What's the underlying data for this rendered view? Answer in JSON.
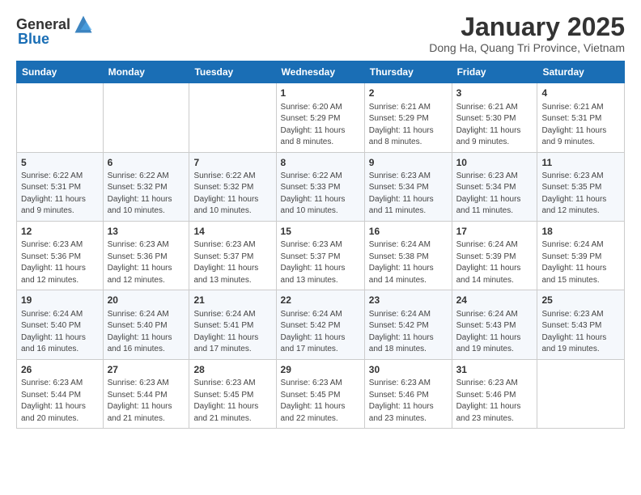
{
  "header": {
    "logo_general": "General",
    "logo_blue": "Blue",
    "month_title": "January 2025",
    "location": "Dong Ha, Quang Tri Province, Vietnam"
  },
  "weekdays": [
    "Sunday",
    "Monday",
    "Tuesday",
    "Wednesday",
    "Thursday",
    "Friday",
    "Saturday"
  ],
  "weeks": [
    [
      {
        "day": "",
        "info": ""
      },
      {
        "day": "",
        "info": ""
      },
      {
        "day": "",
        "info": ""
      },
      {
        "day": "1",
        "info": "Sunrise: 6:20 AM\nSunset: 5:29 PM\nDaylight: 11 hours and 8 minutes."
      },
      {
        "day": "2",
        "info": "Sunrise: 6:21 AM\nSunset: 5:29 PM\nDaylight: 11 hours and 8 minutes."
      },
      {
        "day": "3",
        "info": "Sunrise: 6:21 AM\nSunset: 5:30 PM\nDaylight: 11 hours and 9 minutes."
      },
      {
        "day": "4",
        "info": "Sunrise: 6:21 AM\nSunset: 5:31 PM\nDaylight: 11 hours and 9 minutes."
      }
    ],
    [
      {
        "day": "5",
        "info": "Sunrise: 6:22 AM\nSunset: 5:31 PM\nDaylight: 11 hours and 9 minutes."
      },
      {
        "day": "6",
        "info": "Sunrise: 6:22 AM\nSunset: 5:32 PM\nDaylight: 11 hours and 10 minutes."
      },
      {
        "day": "7",
        "info": "Sunrise: 6:22 AM\nSunset: 5:32 PM\nDaylight: 11 hours and 10 minutes."
      },
      {
        "day": "8",
        "info": "Sunrise: 6:22 AM\nSunset: 5:33 PM\nDaylight: 11 hours and 10 minutes."
      },
      {
        "day": "9",
        "info": "Sunrise: 6:23 AM\nSunset: 5:34 PM\nDaylight: 11 hours and 11 minutes."
      },
      {
        "day": "10",
        "info": "Sunrise: 6:23 AM\nSunset: 5:34 PM\nDaylight: 11 hours and 11 minutes."
      },
      {
        "day": "11",
        "info": "Sunrise: 6:23 AM\nSunset: 5:35 PM\nDaylight: 11 hours and 12 minutes."
      }
    ],
    [
      {
        "day": "12",
        "info": "Sunrise: 6:23 AM\nSunset: 5:36 PM\nDaylight: 11 hours and 12 minutes."
      },
      {
        "day": "13",
        "info": "Sunrise: 6:23 AM\nSunset: 5:36 PM\nDaylight: 11 hours and 12 minutes."
      },
      {
        "day": "14",
        "info": "Sunrise: 6:23 AM\nSunset: 5:37 PM\nDaylight: 11 hours and 13 minutes."
      },
      {
        "day": "15",
        "info": "Sunrise: 6:23 AM\nSunset: 5:37 PM\nDaylight: 11 hours and 13 minutes."
      },
      {
        "day": "16",
        "info": "Sunrise: 6:24 AM\nSunset: 5:38 PM\nDaylight: 11 hours and 14 minutes."
      },
      {
        "day": "17",
        "info": "Sunrise: 6:24 AM\nSunset: 5:39 PM\nDaylight: 11 hours and 14 minutes."
      },
      {
        "day": "18",
        "info": "Sunrise: 6:24 AM\nSunset: 5:39 PM\nDaylight: 11 hours and 15 minutes."
      }
    ],
    [
      {
        "day": "19",
        "info": "Sunrise: 6:24 AM\nSunset: 5:40 PM\nDaylight: 11 hours and 16 minutes."
      },
      {
        "day": "20",
        "info": "Sunrise: 6:24 AM\nSunset: 5:40 PM\nDaylight: 11 hours and 16 minutes."
      },
      {
        "day": "21",
        "info": "Sunrise: 6:24 AM\nSunset: 5:41 PM\nDaylight: 11 hours and 17 minutes."
      },
      {
        "day": "22",
        "info": "Sunrise: 6:24 AM\nSunset: 5:42 PM\nDaylight: 11 hours and 17 minutes."
      },
      {
        "day": "23",
        "info": "Sunrise: 6:24 AM\nSunset: 5:42 PM\nDaylight: 11 hours and 18 minutes."
      },
      {
        "day": "24",
        "info": "Sunrise: 6:24 AM\nSunset: 5:43 PM\nDaylight: 11 hours and 19 minutes."
      },
      {
        "day": "25",
        "info": "Sunrise: 6:23 AM\nSunset: 5:43 PM\nDaylight: 11 hours and 19 minutes."
      }
    ],
    [
      {
        "day": "26",
        "info": "Sunrise: 6:23 AM\nSunset: 5:44 PM\nDaylight: 11 hours and 20 minutes."
      },
      {
        "day": "27",
        "info": "Sunrise: 6:23 AM\nSunset: 5:44 PM\nDaylight: 11 hours and 21 minutes."
      },
      {
        "day": "28",
        "info": "Sunrise: 6:23 AM\nSunset: 5:45 PM\nDaylight: 11 hours and 21 minutes."
      },
      {
        "day": "29",
        "info": "Sunrise: 6:23 AM\nSunset: 5:45 PM\nDaylight: 11 hours and 22 minutes."
      },
      {
        "day": "30",
        "info": "Sunrise: 6:23 AM\nSunset: 5:46 PM\nDaylight: 11 hours and 23 minutes."
      },
      {
        "day": "31",
        "info": "Sunrise: 6:23 AM\nSunset: 5:46 PM\nDaylight: 11 hours and 23 minutes."
      },
      {
        "day": "",
        "info": ""
      }
    ]
  ]
}
